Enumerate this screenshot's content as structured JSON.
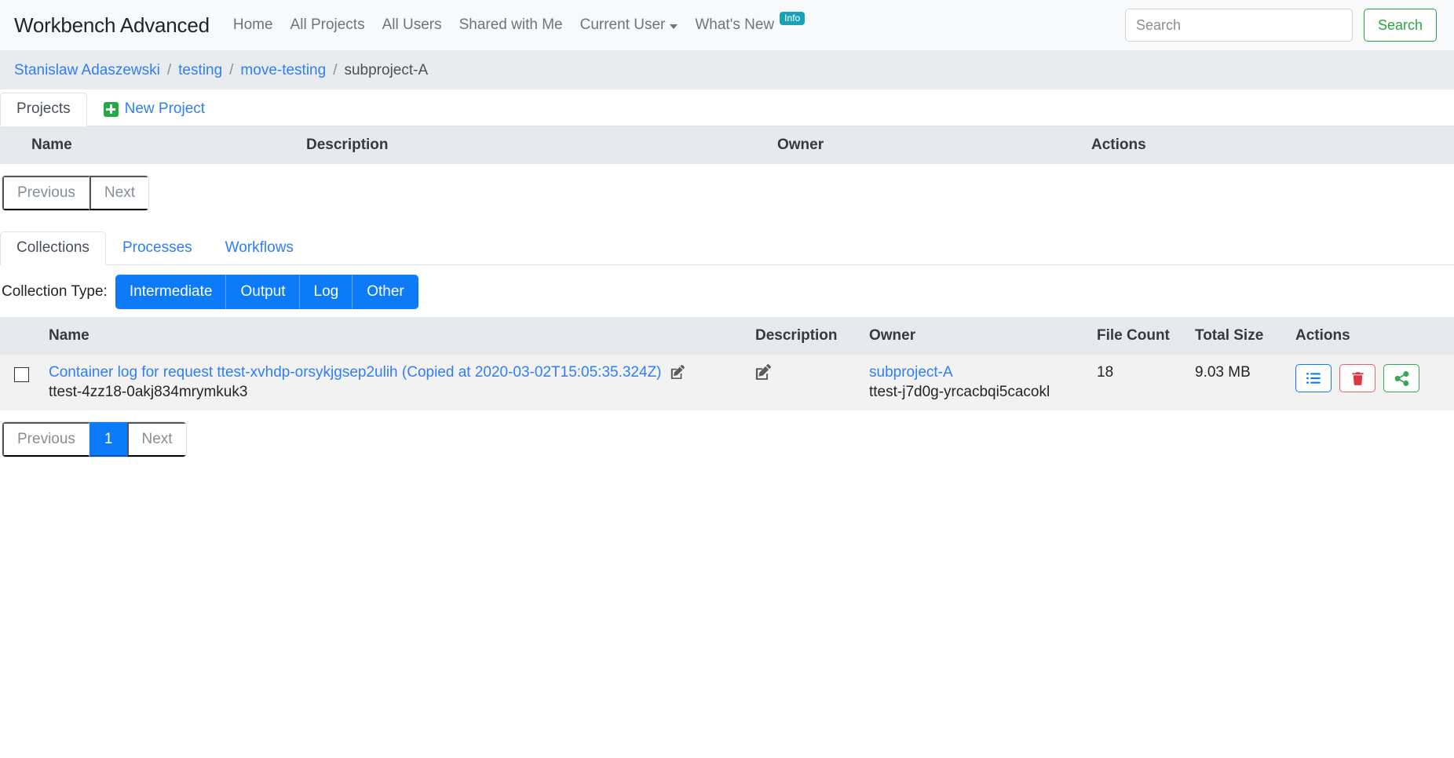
{
  "navbar": {
    "brand": "Workbench Advanced",
    "links": [
      {
        "label": "Home",
        "name": "nav-link-home"
      },
      {
        "label": "All Projects",
        "name": "nav-link-all-projects"
      },
      {
        "label": "All Users",
        "name": "nav-link-all-users"
      },
      {
        "label": "Shared with Me",
        "name": "nav-link-shared-with-me"
      },
      {
        "label": "Current User",
        "name": "nav-link-current-user",
        "dropdown": true
      },
      {
        "label": "What's New",
        "name": "nav-link-whats-new",
        "badge": "Info"
      }
    ],
    "search": {
      "placeholder": "Search",
      "value": "",
      "button_label": "Search"
    }
  },
  "breadcrumb": {
    "separator": "/",
    "items": [
      {
        "label": "Stanislaw Adaszewski",
        "link": true
      },
      {
        "label": "testing",
        "link": true
      },
      {
        "label": "move-testing",
        "link": true
      },
      {
        "label": "subproject-A",
        "link": false
      }
    ]
  },
  "projects_section": {
    "tabs": [
      {
        "label": "Projects",
        "active": true
      },
      {
        "label": "New Project",
        "active": false,
        "icon": "plus-square-icon"
      }
    ],
    "columns": [
      "Name",
      "Description",
      "Owner",
      "Actions"
    ],
    "rows": [],
    "pagination": {
      "previous": "Previous",
      "next": "Next",
      "pages": []
    }
  },
  "collections_section": {
    "tabs": [
      {
        "label": "Collections",
        "active": true
      },
      {
        "label": "Processes",
        "active": false
      },
      {
        "label": "Workflows",
        "active": false
      }
    ],
    "filter": {
      "label": "Collection Type:",
      "options": [
        {
          "label": "Intermediate",
          "active": true
        },
        {
          "label": "Output",
          "active": true
        },
        {
          "label": "Log",
          "active": true
        },
        {
          "label": "Other",
          "active": true
        }
      ]
    },
    "columns": [
      "",
      "Name",
      "Description",
      "Owner",
      "File Count",
      "Total Size",
      "Actions"
    ],
    "rows": [
      {
        "selected": false,
        "name": "Container log for request ttest-xvhdp-orsykjgsep2ulih (Copied at 2020-03-02T15:05:35.324Z)",
        "uuid": "ttest-4zz18-0akj834mrymkuk3",
        "description": "",
        "owner": "subproject-A",
        "owner_uuid": "ttest-j7d0g-yrcacbqi5cacokl",
        "file_count": "18",
        "total_size": "9.03 MB",
        "actions": [
          {
            "name": "details-button",
            "icon": "list-icon",
            "color": "#0d7bf7"
          },
          {
            "name": "delete-button",
            "icon": "trash-icon",
            "color": "#dc3545"
          },
          {
            "name": "share-button",
            "icon": "share-icon",
            "color": "#34a853"
          }
        ]
      }
    ],
    "pagination": {
      "previous": "Previous",
      "next": "Next",
      "pages": [
        {
          "label": "1",
          "active": true
        }
      ]
    }
  },
  "colors": {
    "link": "#2f7ef5",
    "primary": "#0d7bf7",
    "success": "#28a745",
    "danger": "#dc3545",
    "info": "#17a2b8",
    "navbar_bg": "#f8f9fa",
    "breadcrumb_bg": "#e9ecef",
    "table_head_bg": "#e6eaee",
    "row_bg": "#f2f2f2"
  }
}
